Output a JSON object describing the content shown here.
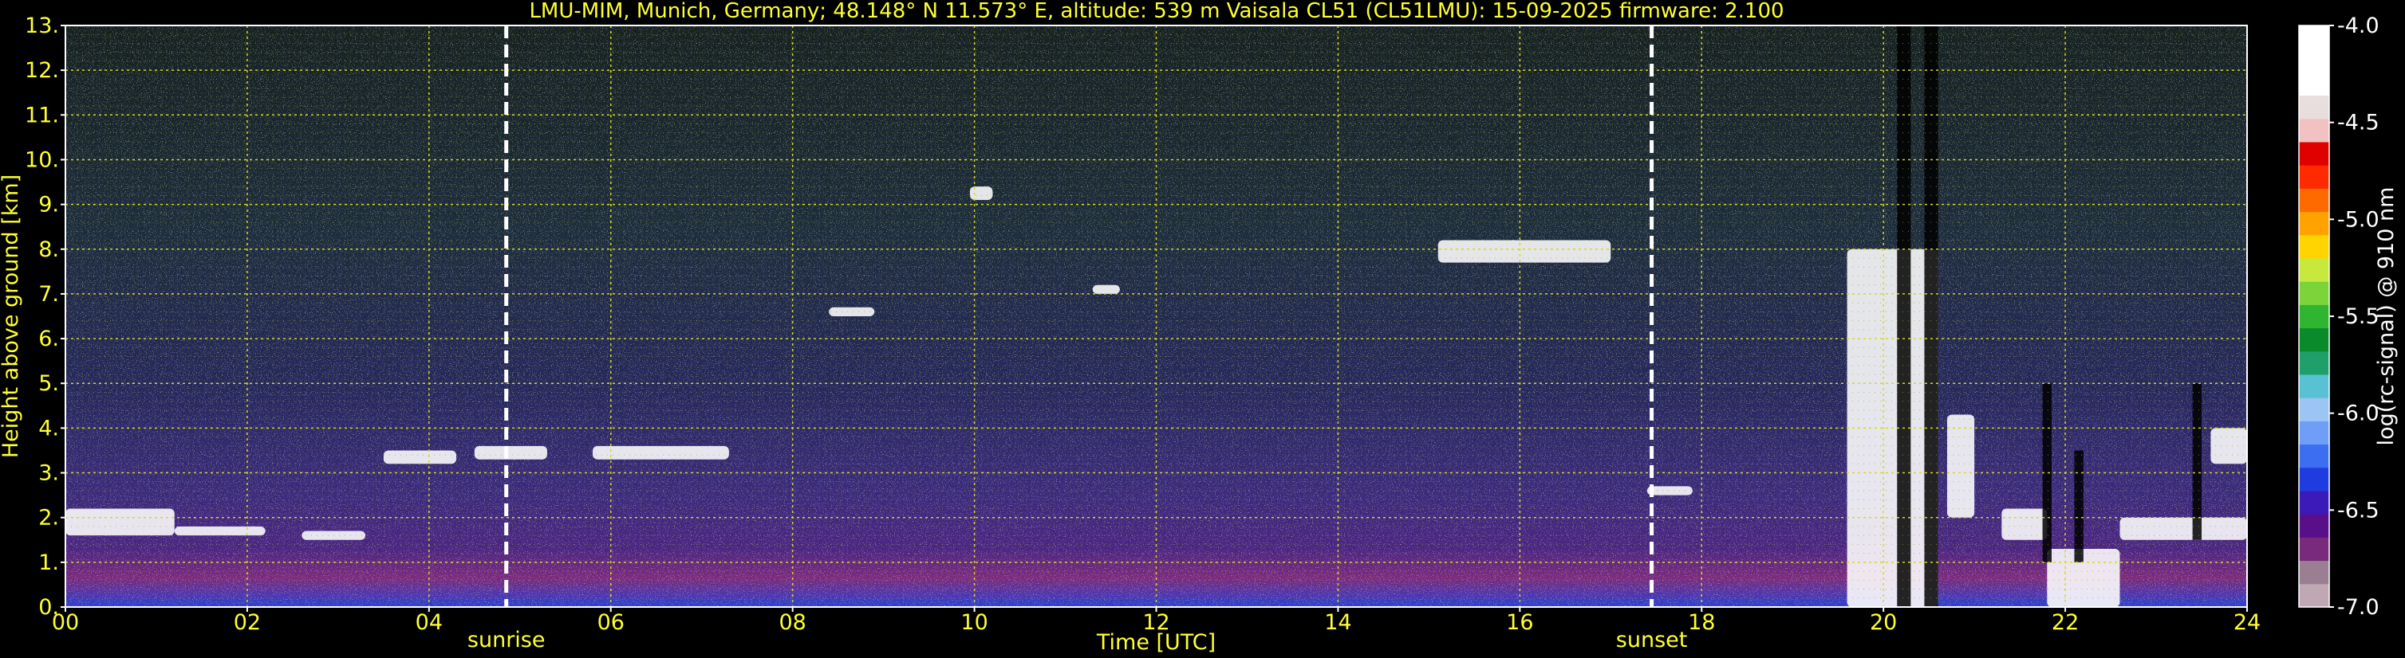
{
  "header": {
    "title": "LMU-MIM, Munich, Germany; 48.148° N 11.573° E, altitude: 539 m    Vaisala CL51 (CL51LMU): 15-09-2025    firmware: 2.100"
  },
  "chart_data": {
    "type": "heatmap",
    "title": "LMU-MIM, Munich, Germany; 48.148° N 11.573° E, altitude: 539 m    Vaisala CL51 (CL51LMU): 15-09-2025    firmware: 2.100",
    "xlabel": "Time [UTC]",
    "ylabel": "Height above ground [km]",
    "xlim": [
      0,
      24
    ],
    "ylim": [
      0,
      13
    ],
    "x_ticks": [
      "00",
      "02",
      "04",
      "06",
      "08",
      "10",
      "12",
      "14",
      "16",
      "18",
      "20",
      "22",
      "24"
    ],
    "y_ticks": [
      "0.",
      "1.",
      "2.",
      "3.",
      "4.",
      "5.",
      "6.",
      "7.",
      "8.",
      "9.",
      "10.",
      "11.",
      "12.",
      "13."
    ],
    "grid": true,
    "annotations": [
      {
        "label": "sunrise",
        "x": 4.85
      },
      {
        "label": "sunset",
        "x": 17.45
      }
    ],
    "colorbar": {
      "label": "log(rc-signal) @ 910 nm",
      "range": [
        -7.0,
        -4.0
      ],
      "ticks": [
        "-4.0",
        "-4.5",
        "-5.0",
        "-5.5",
        "-6.0",
        "-6.5",
        "-7.0"
      ],
      "tick_values": [
        -4.0,
        -4.5,
        -5.0,
        -5.5,
        -6.0,
        -6.5,
        -7.0
      ],
      "colors": [
        "#bfa8b4",
        "#9a7f92",
        "#7a2a7c",
        "#5a0f8a",
        "#3a1ab8",
        "#1f3ce0",
        "#3b6ef0",
        "#6e9ef5",
        "#9cc4f5",
        "#58c2d4",
        "#1f9f6a",
        "#0b8a2c",
        "#2fb52f",
        "#7ad43a",
        "#c7e83c",
        "#ffd400",
        "#ffa200",
        "#ff6a00",
        "#ff2a00",
        "#e00000",
        "#f2c2c2",
        "#e8dede",
        "#ffffff",
        "#ffffff",
        "#ffffff"
      ],
      "legend_placement": "right"
    },
    "features": [
      {
        "kind": "cloud",
        "x": [
          0.0,
          1.2
        ],
        "y": [
          1.6,
          2.2
        ]
      },
      {
        "kind": "cloud",
        "x": [
          1.2,
          2.2
        ],
        "y": [
          1.6,
          1.8
        ]
      },
      {
        "kind": "cloud",
        "x": [
          2.6,
          3.3
        ],
        "y": [
          1.5,
          1.7
        ]
      },
      {
        "kind": "cloud",
        "x": [
          3.5,
          4.3
        ],
        "y": [
          3.2,
          3.5
        ]
      },
      {
        "kind": "cloud",
        "x": [
          4.5,
          5.3
        ],
        "y": [
          3.3,
          3.6
        ]
      },
      {
        "kind": "cloud",
        "x": [
          5.8,
          7.3
        ],
        "y": [
          3.3,
          3.6
        ]
      },
      {
        "kind": "cloud",
        "x": [
          8.4,
          8.9
        ],
        "y": [
          6.5,
          6.7
        ]
      },
      {
        "kind": "cloud",
        "x": [
          9.95,
          10.2
        ],
        "y": [
          9.1,
          9.4
        ]
      },
      {
        "kind": "cloud",
        "x": [
          11.3,
          11.6
        ],
        "y": [
          7.0,
          7.2
        ]
      },
      {
        "kind": "cloud",
        "x": [
          15.1,
          17.0
        ],
        "y": [
          7.7,
          8.2
        ]
      },
      {
        "kind": "cloud",
        "x": [
          17.4,
          17.9
        ],
        "y": [
          2.5,
          2.7
        ]
      },
      {
        "kind": "cloud",
        "x": [
          19.6,
          20.6
        ],
        "y": [
          0.0,
          8.0
        ]
      },
      {
        "kind": "cloud",
        "x": [
          20.7,
          21.0
        ],
        "y": [
          2.0,
          4.3
        ]
      },
      {
        "kind": "cloud",
        "x": [
          21.3,
          21.8
        ],
        "y": [
          1.5,
          2.2
        ]
      },
      {
        "kind": "cloud",
        "x": [
          21.8,
          22.6
        ],
        "y": [
          0.0,
          1.3
        ]
      },
      {
        "kind": "cloud",
        "x": [
          22.6,
          24.0
        ],
        "y": [
          1.5,
          2.0
        ]
      },
      {
        "kind": "cloud",
        "x": [
          23.6,
          24.0
        ],
        "y": [
          3.2,
          4.0
        ]
      },
      {
        "kind": "signal-gap",
        "x": [
          20.15,
          20.3
        ],
        "y": [
          0.0,
          13.0
        ]
      },
      {
        "kind": "signal-gap",
        "x": [
          20.45,
          20.6
        ],
        "y": [
          0.0,
          13.0
        ]
      },
      {
        "kind": "signal-gap",
        "x": [
          21.75,
          21.85
        ],
        "y": [
          1.0,
          5.0
        ]
      },
      {
        "kind": "signal-gap",
        "x": [
          22.1,
          22.2
        ],
        "y": [
          1.0,
          3.5
        ]
      },
      {
        "kind": "signal-gap",
        "x": [
          23.4,
          23.5
        ],
        "y": [
          1.5,
          5.0
        ]
      }
    ]
  }
}
